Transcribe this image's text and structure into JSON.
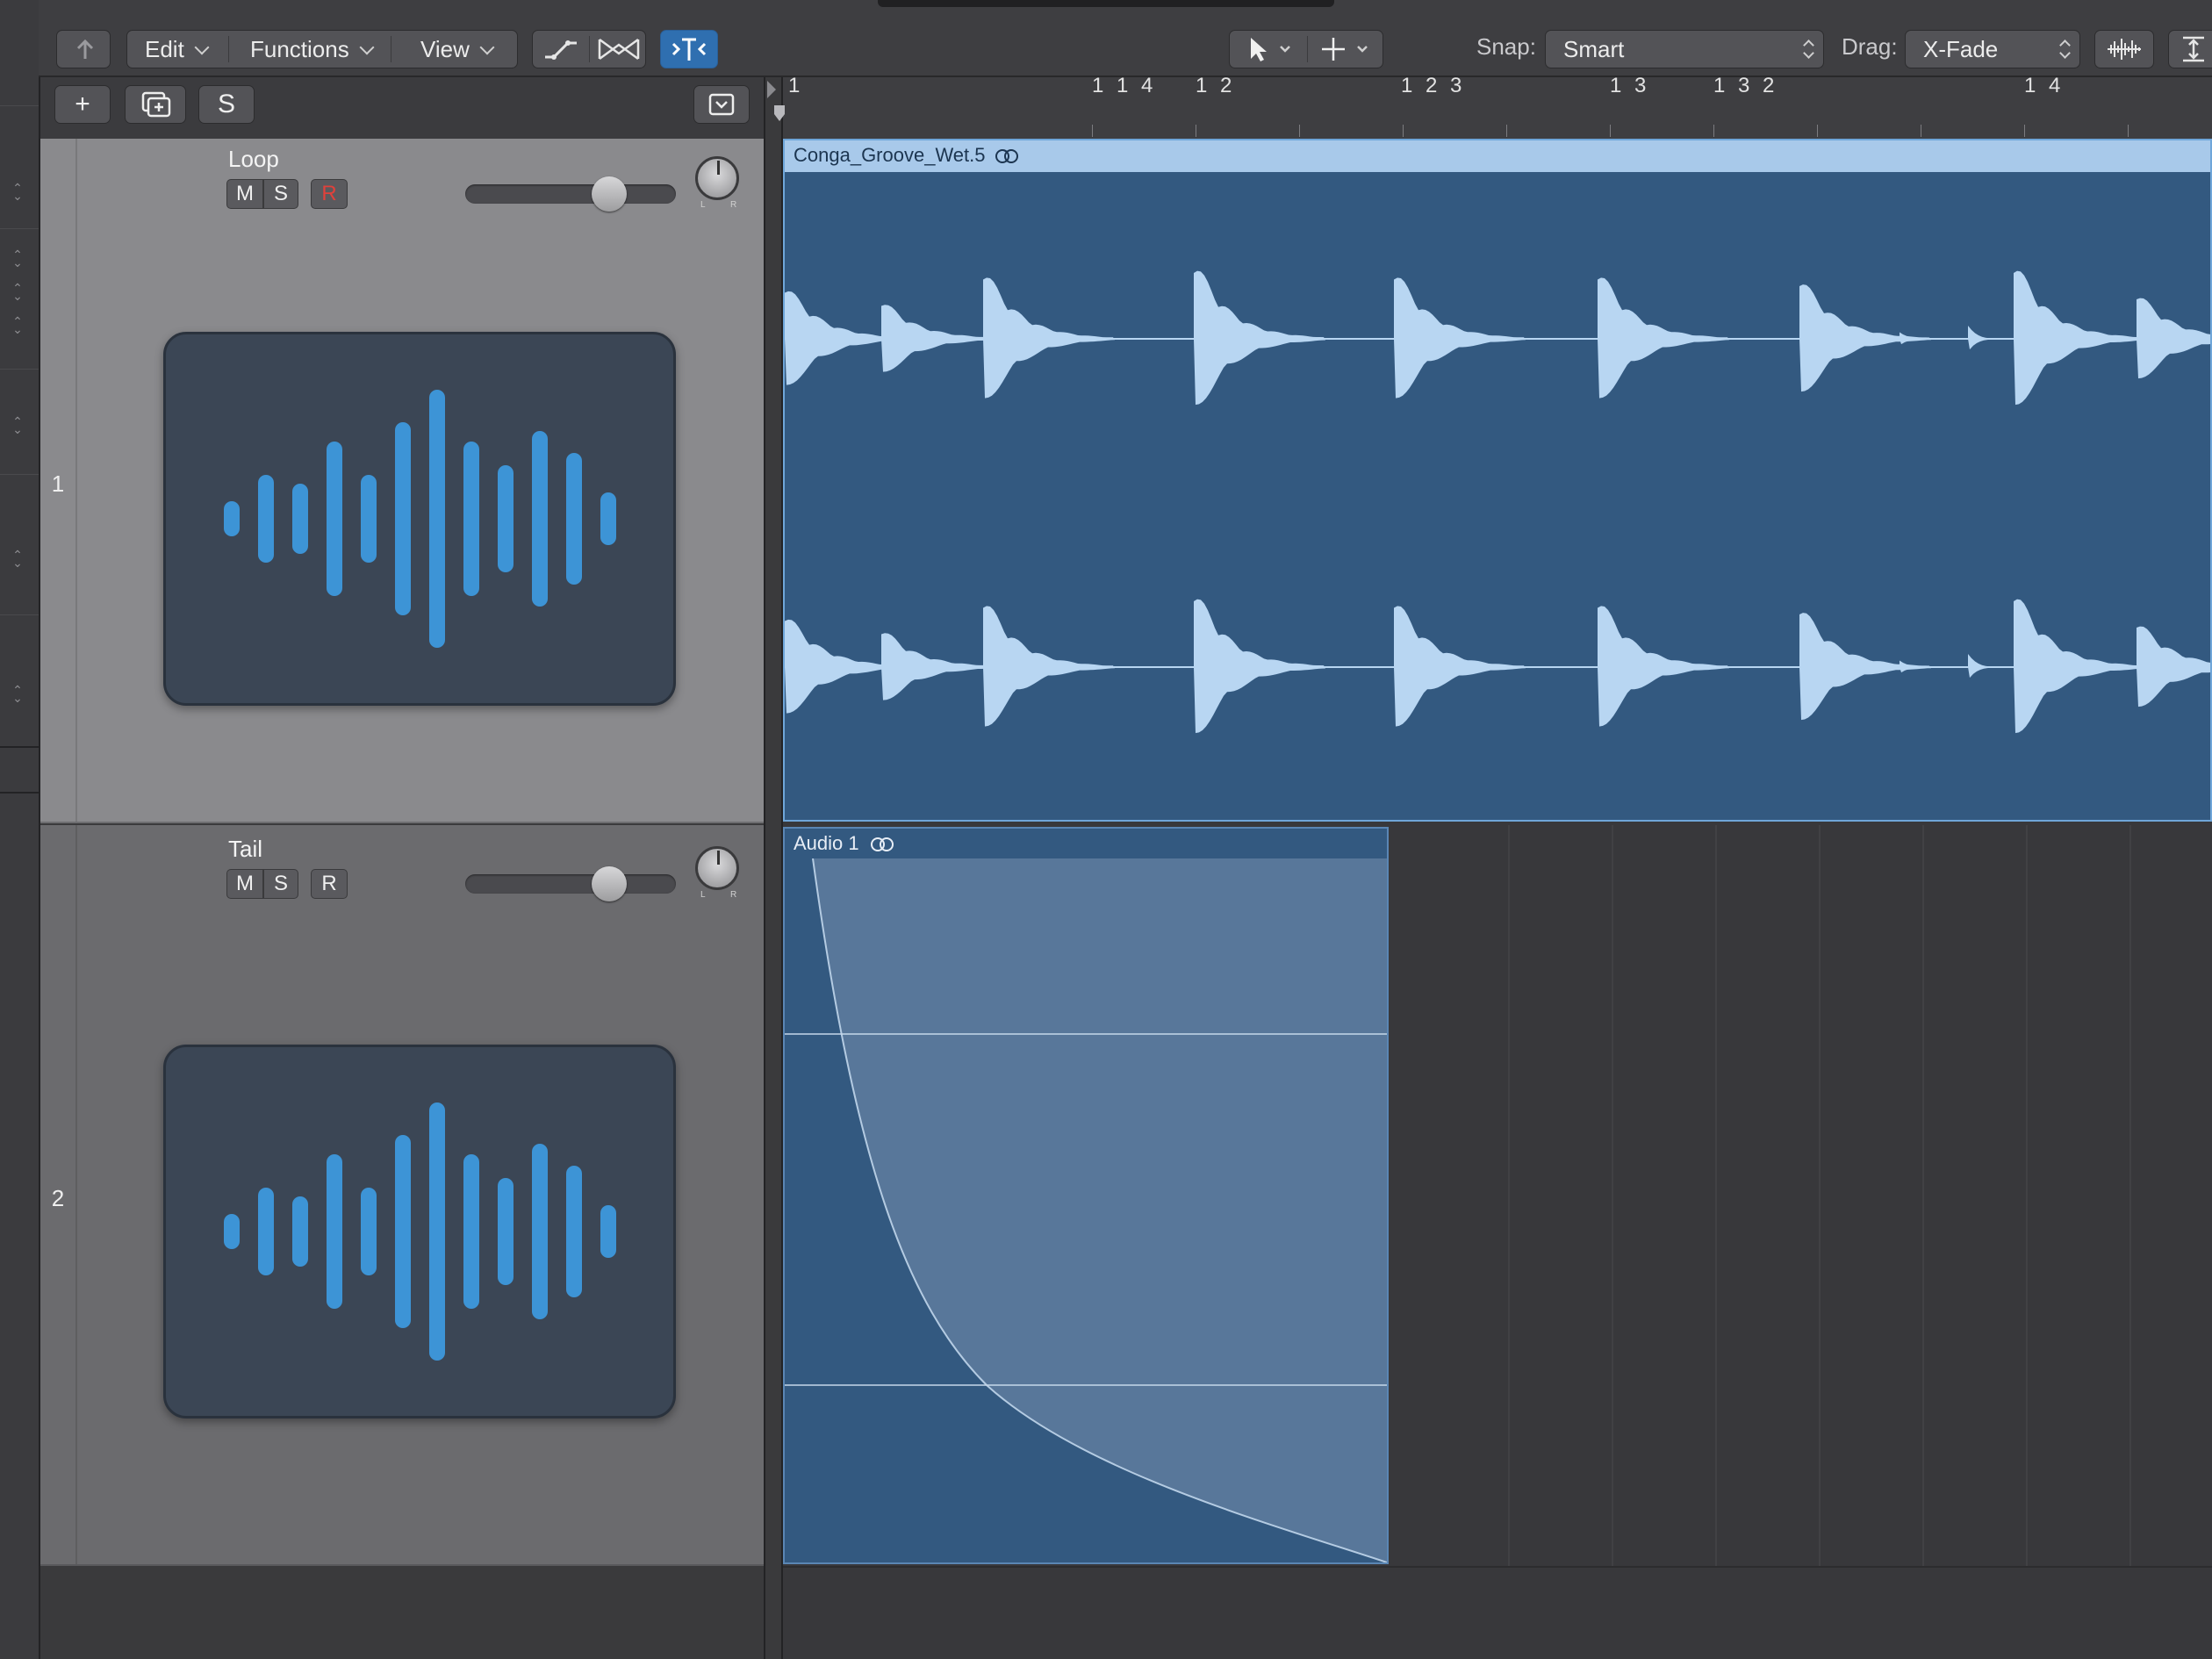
{
  "toolbar": {
    "edit_label": "Edit",
    "functions_label": "Functions",
    "view_label": "View",
    "snap_label": "Snap:",
    "snap_value": "Smart",
    "drag_label": "Drag:",
    "drag_value": "X-Fade"
  },
  "header_toolbar": {
    "add_label": "+",
    "solo_label": "S"
  },
  "tracks": [
    {
      "number": "1",
      "name": "Loop",
      "mute": "M",
      "solo": "S",
      "record": "R",
      "record_armed_color": "#e0413b",
      "pan_l": "L",
      "pan_r": "R",
      "volume_fraction": 0.72
    },
    {
      "number": "2",
      "name": "Tail",
      "mute": "M",
      "solo": "S",
      "record": "R",
      "pan_l": "L",
      "pan_r": "R",
      "volume_fraction": 0.72
    }
  ],
  "ruler": {
    "labels": [
      "1",
      "1 1 4",
      "1 2",
      "1 2 3",
      "1 3",
      "1 3 2",
      "1 4"
    ]
  },
  "regions": [
    {
      "name": "Conga_Groove_Wet.5",
      "color": "#335980",
      "header_color": "#a8c9ea"
    },
    {
      "name": "Audio 1",
      "color": "#335980"
    }
  ],
  "colors": {
    "accent_blue": "#3d94d6",
    "waveform": "#b8d6f2",
    "selected_tool": "#2f6fb0"
  }
}
